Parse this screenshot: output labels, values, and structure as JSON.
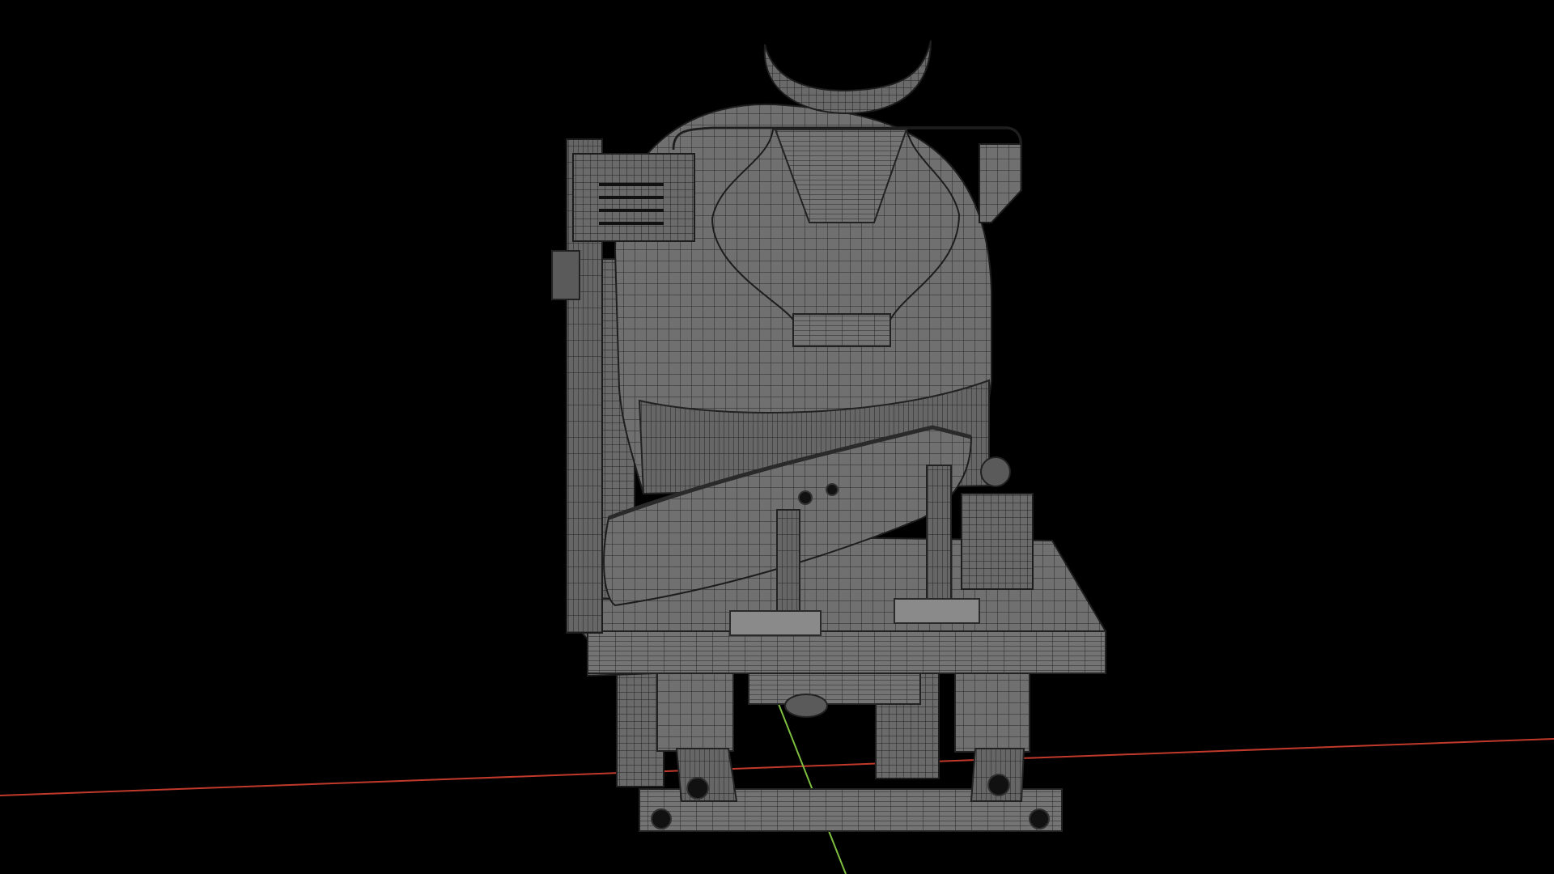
{
  "viewport": {
    "background_color": "#000000",
    "mesh_fill_color": "#6f6f6f",
    "wire_color": "#262626",
    "axis_x_color": "#c0392b",
    "axis_y_color": "#7fbf3f"
  },
  "model": {
    "icon": "cement-mixer-truck-wireframe"
  }
}
